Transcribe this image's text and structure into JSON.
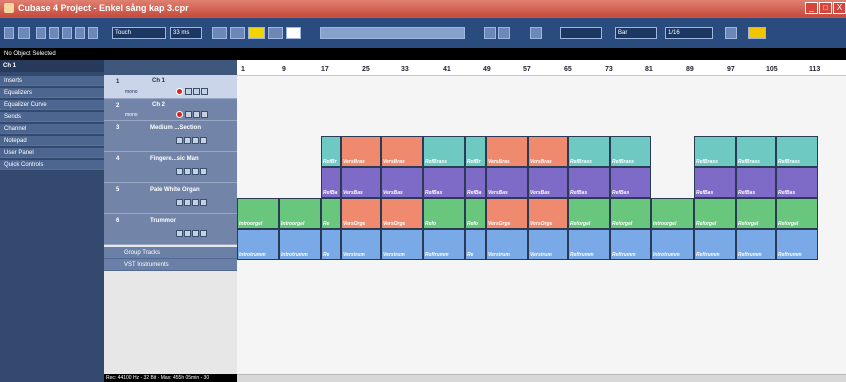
{
  "window": {
    "title": "Cubase 4 Project - Enkel sång kap 3.cpr",
    "controls": [
      "_",
      "□",
      "X"
    ]
  },
  "toolbar": {
    "automation_mode": "Touch",
    "latency": "33 ms",
    "snap_label": "Bar",
    "quantize": "1/16"
  },
  "status": {
    "selection": "No Object Selected",
    "bottom": "Rec: 44100 Hz - 32 Bit - Max: 455h 05min - 30"
  },
  "inspector": {
    "channel": "Ch 1",
    "items": [
      "Inserts",
      "Equalizers",
      "Equalizer Curve",
      "Sends",
      "Channel",
      "Notepad",
      "User Panel",
      "Quick Controls"
    ]
  },
  "tracks": [
    {
      "num": "1",
      "name": "Ch 1",
      "sub": "mono",
      "selected": true
    },
    {
      "num": "2",
      "name": "Ch 2",
      "sub": "mono",
      "selected": false
    },
    {
      "num": "3",
      "name": "Medium ...Section",
      "sub": "",
      "selected": false
    },
    {
      "num": "4",
      "name": "Fingere...sic Man",
      "sub": "",
      "selected": false
    },
    {
      "num": "5",
      "name": "Pale White Organ",
      "sub": "",
      "selected": false
    },
    {
      "num": "6",
      "name": "Trummor",
      "sub": "",
      "selected": false
    }
  ],
  "folders": [
    "Group Tracks",
    "VST Instruments"
  ],
  "ruler": {
    "bars": [
      "1",
      "9",
      "17",
      "25",
      "33",
      "41",
      "49",
      "57",
      "65",
      "73",
      "81",
      "89",
      "97",
      "105",
      "113"
    ]
  },
  "parts": {
    "t3": [
      "RefBr",
      "VersBras",
      "VersBras",
      "RefBrass",
      "RefBr",
      "VersBras",
      "VersBras",
      "RefBrass",
      "RefBrass",
      "RefBrass",
      "RefBrass",
      "RefBrass"
    ],
    "t4": [
      "RefBa",
      "VersBas",
      "VersBas",
      "RefBas",
      "RefBa",
      "VersBas",
      "VersBas",
      "RefBas",
      "RefBas",
      "RefBas",
      "RefBas",
      "RefBas"
    ],
    "t5": [
      "Introorgel",
      "Introorgel",
      "Re",
      "VersOrge",
      "VersOrge",
      "Refo",
      "Refo",
      "VersOrge",
      "VersOrge",
      "Reforgel",
      "Reforgel",
      "Introorgel",
      "Reforgel",
      "Reforgel",
      "Reforgel"
    ],
    "t6": [
      "Introtrumm",
      "Introtrumm",
      "Re",
      "Verstrum",
      "Verstrum",
      "Reftrumm",
      "Re",
      "Verstrum",
      "Verstrum",
      "Reftrumm",
      "Reftrumm",
      "Introtrumm",
      "Reftrumm",
      "Reftrumm",
      "Reftrumm"
    ]
  },
  "colors": {
    "titlebar": "#c64b3d",
    "toolbar": "#2a4b7d",
    "brass_ref": "#66c9c0",
    "brass_vers": "#f08a6e",
    "bass": "#7d6bc7",
    "organ": "#68c77c",
    "organ_vers": "#f08a6e",
    "drums": "#7aa9e8"
  }
}
